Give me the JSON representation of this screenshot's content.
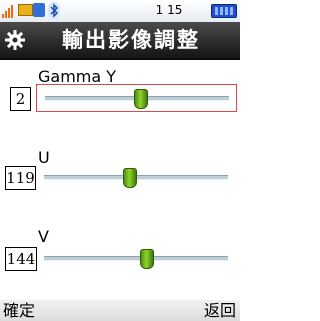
{
  "status_bar": {
    "time": "1 15",
    "icons": [
      "signal-icon",
      "message-icon",
      "wallet-icon",
      "bluetooth-icon",
      "battery-icon"
    ]
  },
  "header": {
    "title": "輸出影像調整",
    "icon": "gear-icon"
  },
  "settings": [
    {
      "label": "Gamma Y",
      "value": "2",
      "level": 0.52,
      "focused": true
    },
    {
      "label": "U",
      "value": "119",
      "level": 0.47,
      "focused": false
    },
    {
      "label": "V",
      "value": "144",
      "level": 0.56,
      "focused": false
    }
  ],
  "softkeys": {
    "left": "確定",
    "right": "返回"
  },
  "colors": {
    "title_bar": "#1e1e1e",
    "focus_border": "#d84a4a",
    "thumb": "#6fb51e",
    "status_time": "#000000"
  }
}
